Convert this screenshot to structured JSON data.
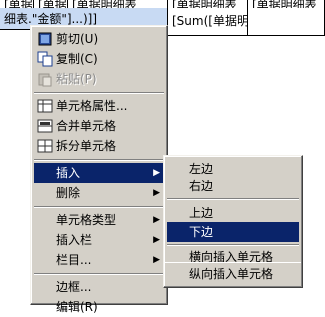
{
  "grid": {
    "row1": [
      "[单据",
      "[单据",
      "[单据明细表",
      "[单据明细表",
      "[单据明细表"
    ],
    "row2": [
      "细表.\"金额\"]...)]]",
      "",
      "[Sum([单据明"
    ]
  },
  "menu": {
    "items": [
      {
        "label": "剪切(U)",
        "icon": "cut-icon"
      },
      {
        "label": "复制(C)",
        "icon": "copy-icon"
      },
      {
        "label": "粘贴(P)",
        "icon": "paste-icon",
        "disabled": true
      },
      {
        "label": "单元格属性...",
        "icon": "cell-properties-icon"
      },
      {
        "label": "合并单元格",
        "icon": "merge-cells-icon"
      },
      {
        "label": "拆分单元格",
        "icon": "split-cells-icon"
      },
      {
        "label": "插入",
        "submenu": true,
        "highlighted": true
      },
      {
        "label": "删除",
        "submenu": true
      },
      {
        "label": "单元格类型",
        "submenu": true
      },
      {
        "label": "插入栏",
        "submenu": true
      },
      {
        "label": "栏目...",
        "submenu": true
      },
      {
        "label": "边框..."
      },
      {
        "label": "编辑(R)"
      }
    ]
  },
  "submenu": {
    "items": [
      {
        "label": "左边"
      },
      {
        "label": "右边"
      },
      {
        "label": "上边"
      },
      {
        "label": "下边",
        "highlighted": true
      },
      {
        "label": "横向插入单元格"
      },
      {
        "label": "纵向插入单元格"
      }
    ]
  },
  "colors": {
    "highlight": "#0a246a",
    "menu_bg": "#d4d0c8",
    "selection": "#c8daf3"
  }
}
